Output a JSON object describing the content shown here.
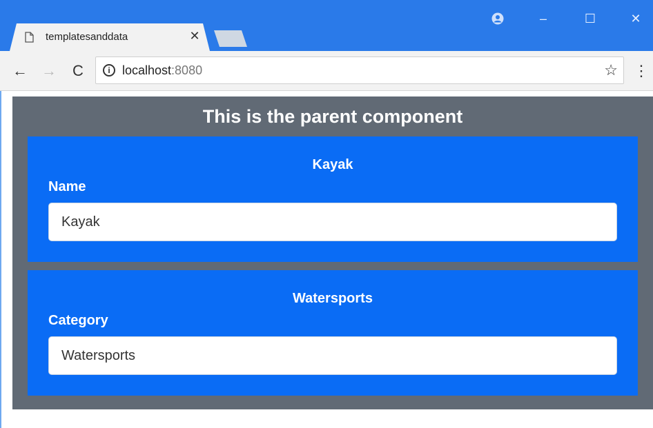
{
  "browser": {
    "tab_title": "templatesanddata",
    "tab_close": "✕",
    "window_controls": {
      "minimize": "–",
      "maximize": "☐",
      "close": "✕"
    },
    "toolbar": {
      "back": "←",
      "forward": "→",
      "reload": "C",
      "menu": "⋮",
      "star": "☆"
    },
    "url": {
      "host": "localhost",
      "port": ":8080"
    },
    "icons": [
      "page-icon",
      "profile-icon",
      "info-icon",
      "star-icon"
    ]
  },
  "page": {
    "parent_title": "This is the parent component",
    "children": [
      {
        "title": "Kayak",
        "label": "Name",
        "value": "Kayak"
      },
      {
        "title": "Watersports",
        "label": "Category",
        "value": "Watersports"
      }
    ]
  },
  "colors": {
    "titlebar": "#2a7ae9",
    "parent_bg": "#616a75",
    "child_bg": "#0a6cf5"
  }
}
